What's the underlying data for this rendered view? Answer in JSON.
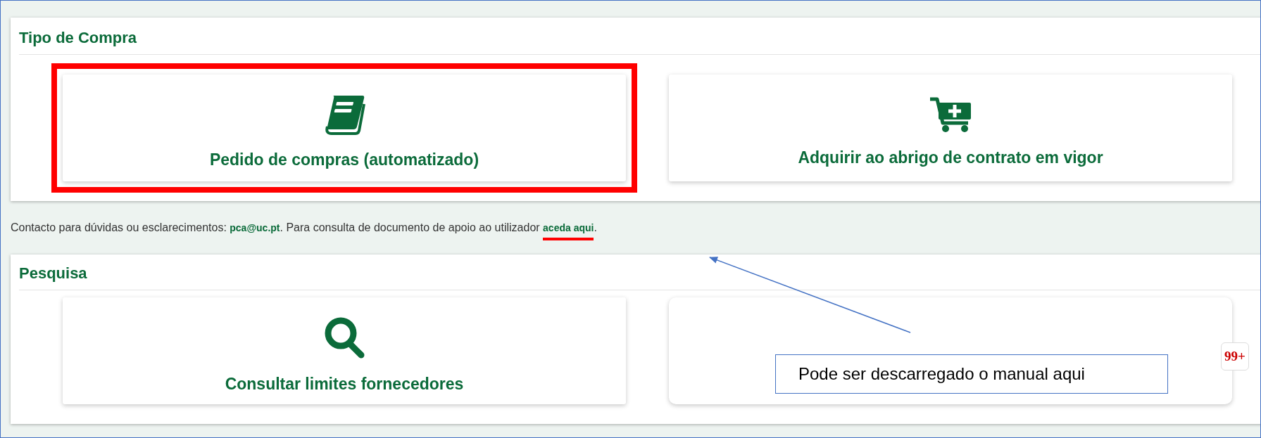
{
  "sections": [
    {
      "title": "Tipo de Compra",
      "cards": [
        {
          "kind": "book",
          "label": "Pedido de compras (automatizado)",
          "highlighted": true
        },
        {
          "kind": "cart-plus",
          "label": "Adquirir ao abrigo de contrato em vigor",
          "highlighted": false
        }
      ]
    },
    {
      "title": "Pesquisa",
      "cards": [
        {
          "kind": "search",
          "label": "Consultar limites fornecedores",
          "highlighted": false
        },
        {
          "kind": "empty",
          "highlighted": false
        }
      ]
    }
  ],
  "contact": {
    "before": "Contacto para dúvidas ou esclarecimentos: ",
    "email": "pca@uc.pt",
    "middle": ". Para consulta de documento de apoio ao utilizador ",
    "link": "aceda aqui",
    "after": ".",
    "link_underlined": true
  },
  "annotation": {
    "callout": "Pode ser descarregado o manual aqui",
    "badge": "99+"
  }
}
